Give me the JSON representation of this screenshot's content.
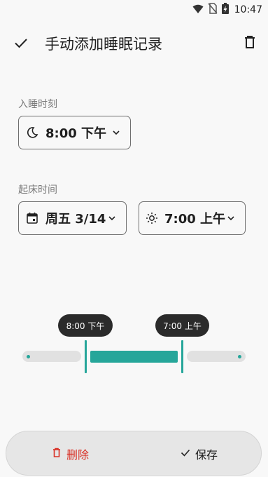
{
  "status_bar": {
    "time": "10:47"
  },
  "app_bar": {
    "title": "手动添加睡眠记录"
  },
  "bedtime": {
    "label": "入睡时刻",
    "time": "8:00 下午"
  },
  "wake": {
    "label": "起床时间",
    "date": "周五 3/14",
    "time": "7:00 上午"
  },
  "timeline": {
    "start_label": "8:00 下午",
    "end_label": "7:00 上午"
  },
  "actions": {
    "delete_label": "删除",
    "save_label": "保存"
  },
  "colors": {
    "accent": "#26a69a",
    "danger": "#d93025",
    "bubble": "#2b2b2b"
  },
  "icons": [
    "wifi-icon",
    "no-sim-icon",
    "battery-charging-icon",
    "check-icon",
    "trash-icon",
    "moon-icon",
    "calendar-icon",
    "sun-icon",
    "chevron-down-icon"
  ]
}
